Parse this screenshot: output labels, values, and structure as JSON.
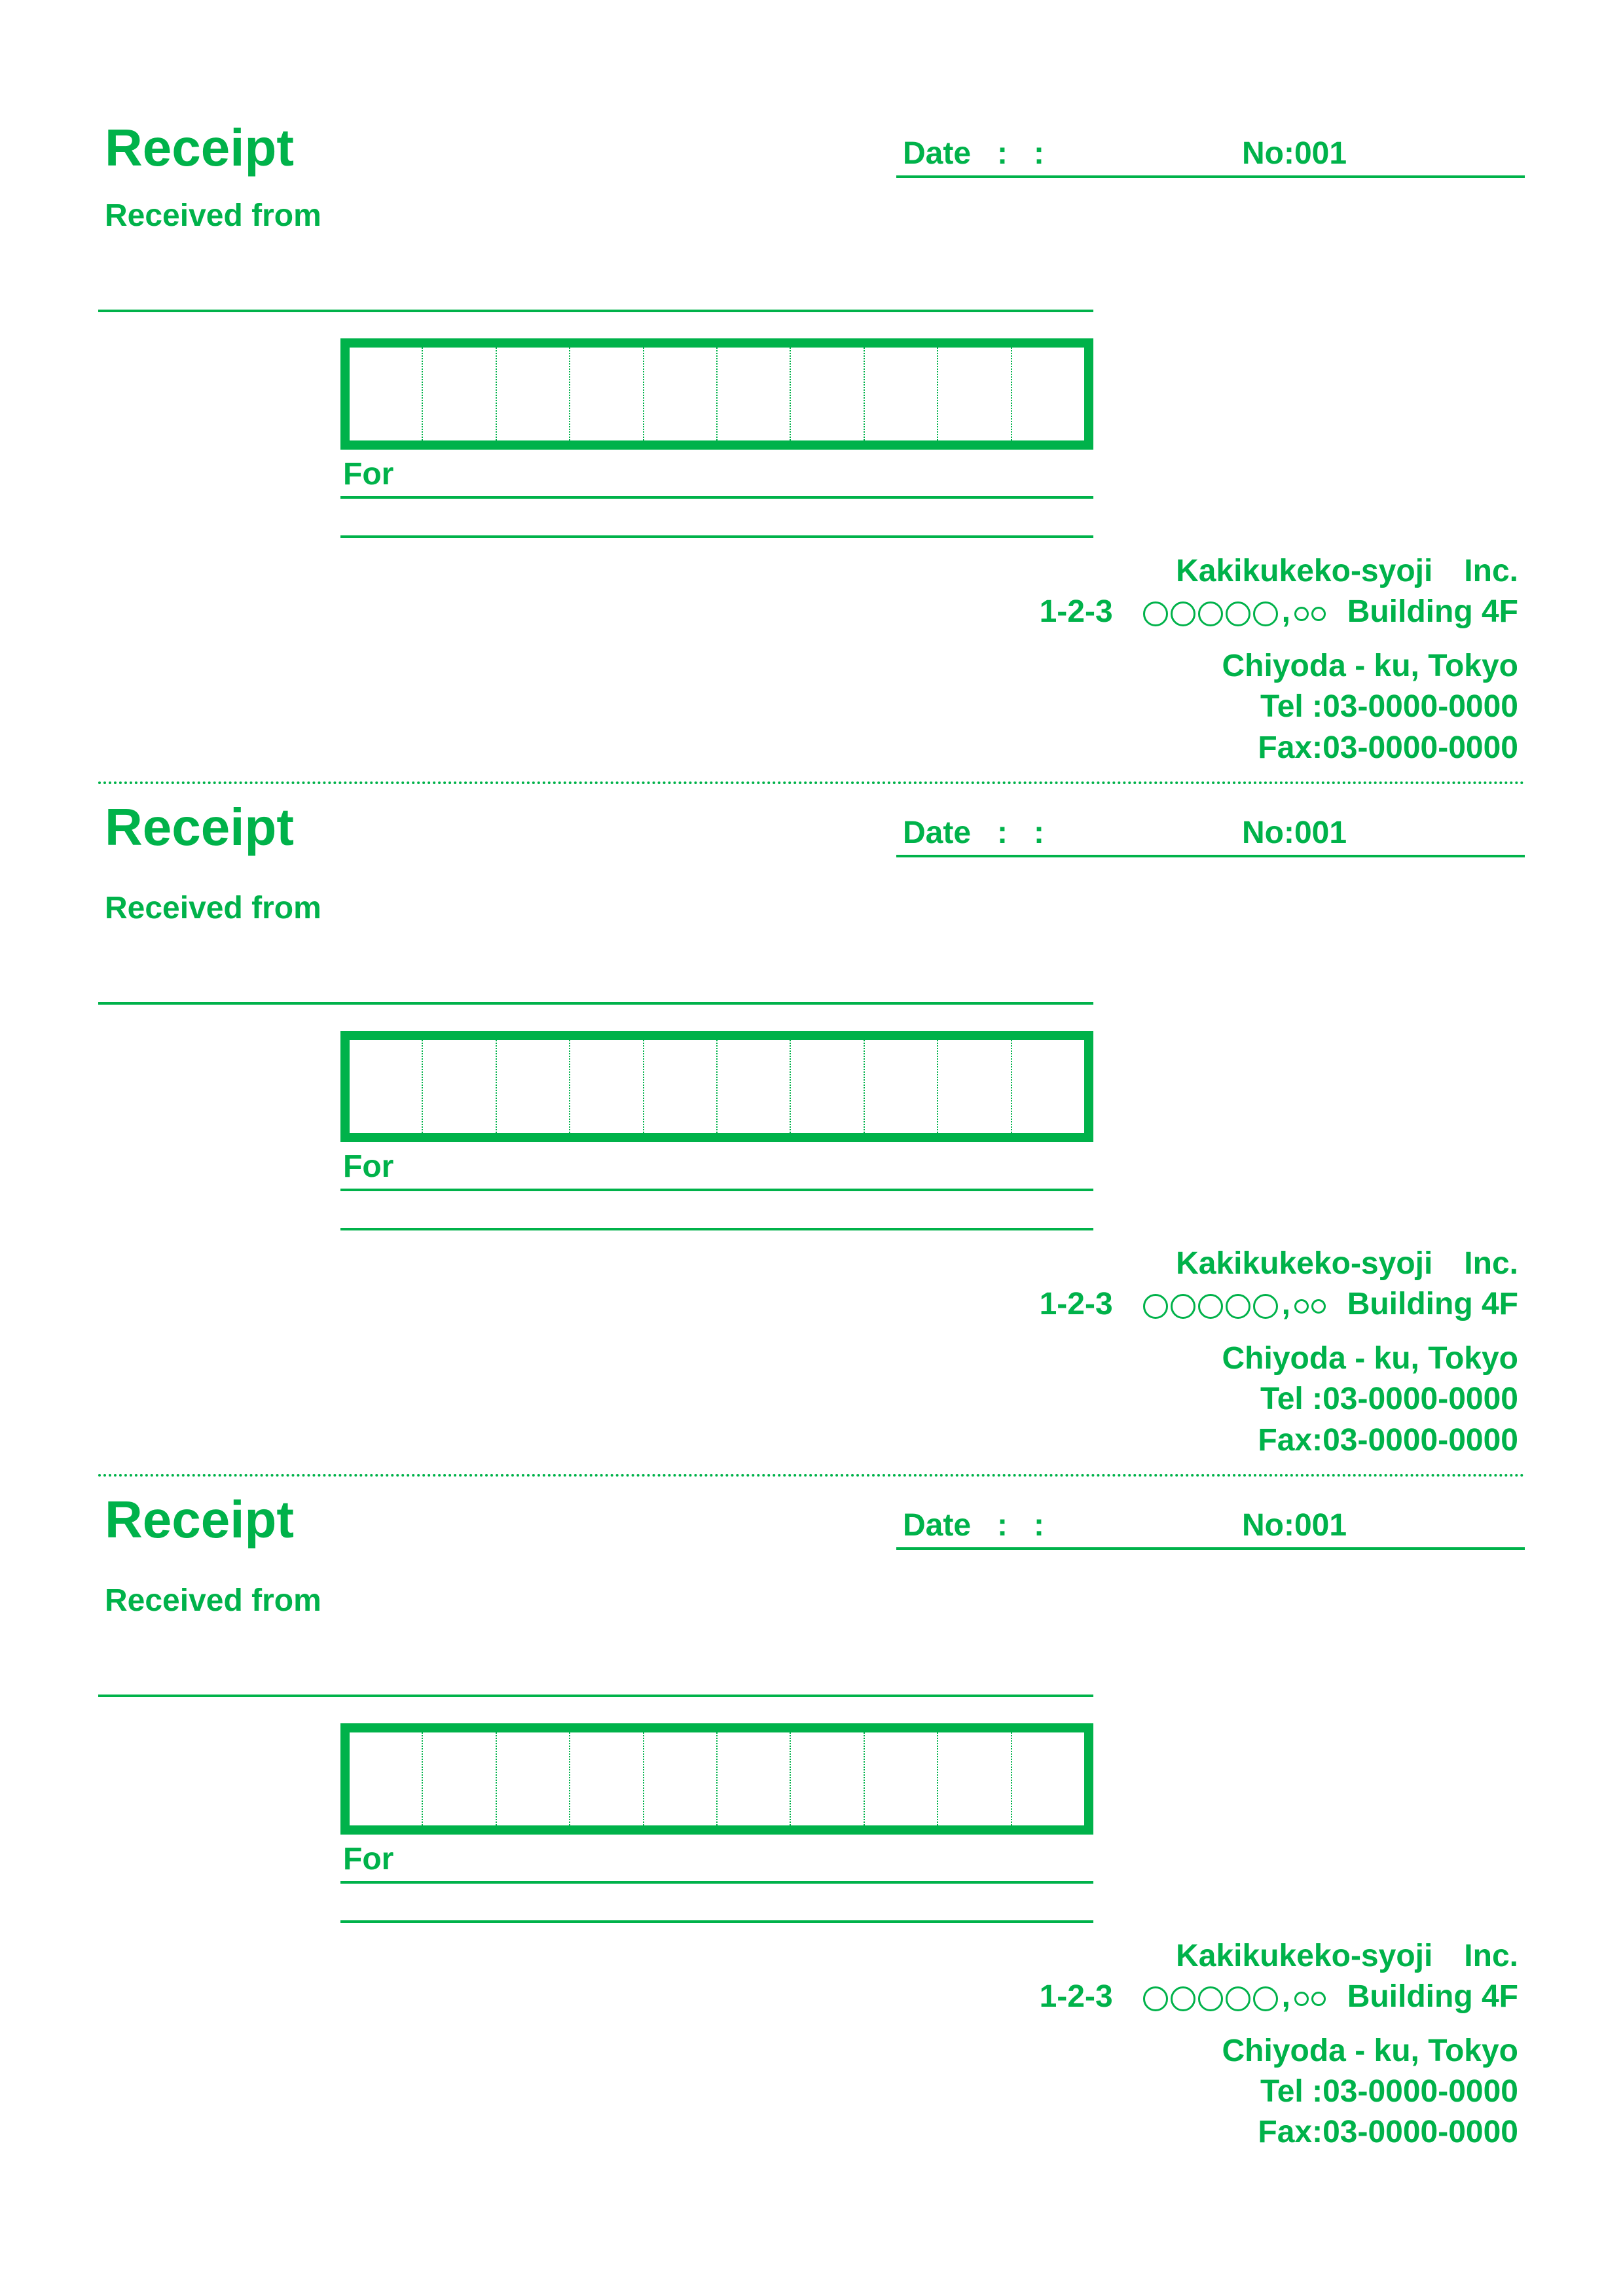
{
  "labels": {
    "title": "Receipt",
    "date": "Date",
    "colon": ":",
    "no_prefix": "No:",
    "received_from": "Received from",
    "for": "For"
  },
  "no_value": "001",
  "digits": 10,
  "issuer": {
    "name": "Kakikukeko-syoji　Inc.",
    "addr_prefix": "1-2-3",
    "addr_suffix": "Building 4F",
    "city": "Chiyoda - ku, Tokyo",
    "tel_label": "Tel :",
    "tel": "03-0000-0000",
    "fax_label": "Fax:",
    "fax": "03-0000-0000"
  },
  "copies": 3
}
